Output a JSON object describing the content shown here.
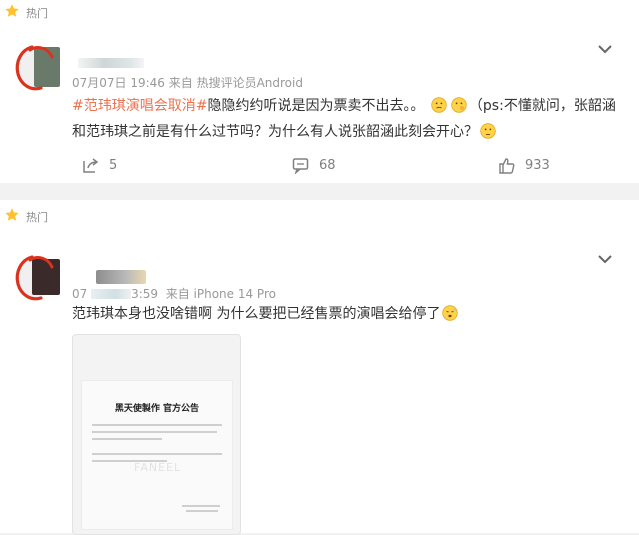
{
  "posts": [
    {
      "section_label": "热门",
      "username": "",
      "meta": "07月07日 19:46  来自 热搜评论员Android",
      "text_segments": [
        {
          "text": "#范玮琪演唱会取消#",
          "type": "hashtag"
        },
        {
          "text": "隐隐约约听说是因为票卖不出去。。",
          "type": "text"
        }
      ],
      "text_segments_b": [
        {
          "text": "（ps:不懂就问，张韶涵",
          "type": "text"
        }
      ],
      "text_line2": "和范玮琪之前是有什么过节吗？为什么有人说张韶涵此刻会开心？",
      "emojis": [
        "thinking-face-icon",
        "thinking-face-icon",
        "thinking-face-icon"
      ],
      "actions": {
        "share": "5",
        "comment": "68",
        "like": "933"
      }
    },
    {
      "section_label": "热门",
      "username": "",
      "meta_prefix": "07",
      "meta_time": "3:59",
      "meta_source": "来自 iPhone 14 Pro",
      "text": "范玮琪本身也没啥错啊 为什么要把已经售票的演唱会给停了",
      "emoji": "sweat-face-icon",
      "notice": {
        "title": "黑天使製作 官方公告",
        "watermark": "FANEEL"
      }
    }
  ],
  "colors": {
    "hashtag": "#eb7350",
    "annotation_circle": "#d9331f",
    "meta": "#999999",
    "action": "#808080"
  }
}
